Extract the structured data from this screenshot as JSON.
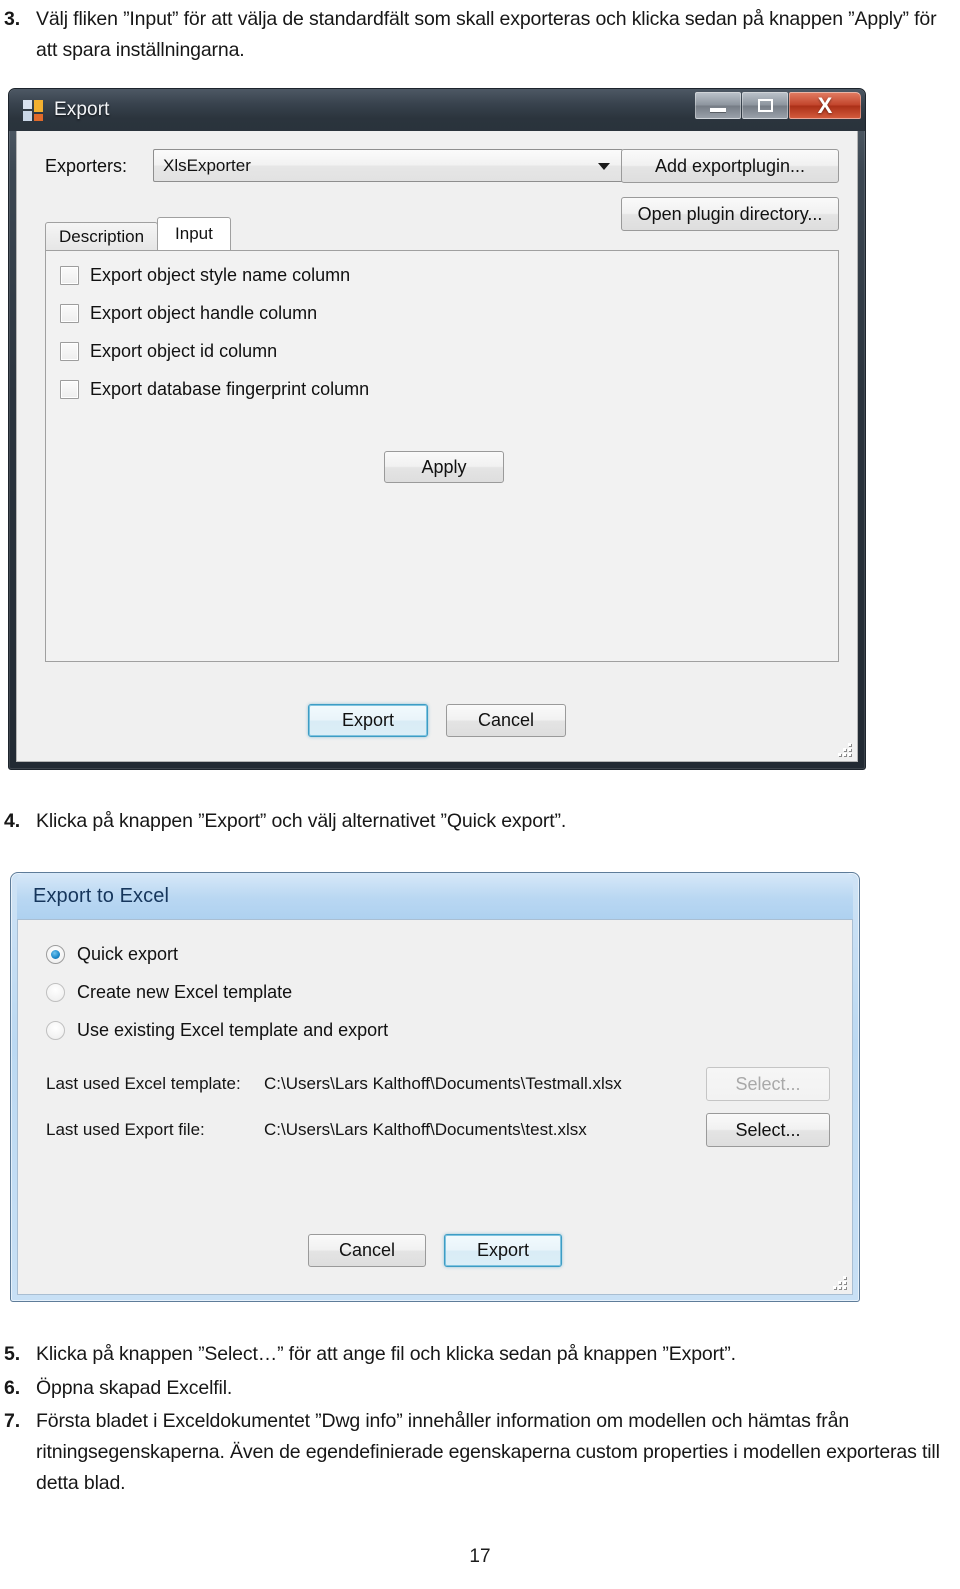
{
  "document": {
    "page_number": "17",
    "steps": [
      {
        "number": "3.",
        "text": "Välj fliken ”Input” för att välja de standardfält som skall exporteras och klicka sedan på knappen ”Apply” för att spara inställningarna."
      },
      {
        "number": "4.",
        "text": "Klicka på knappen ”Export” och välj alternativet ”Quick export”."
      },
      {
        "number": "5.",
        "text": "Klicka på knappen ”Select…” för att ange fil och klicka sedan på knappen ”Export”."
      },
      {
        "number": "6.",
        "text": "Öppna skapad Excelfil."
      },
      {
        "number": "7.",
        "text": "Första bladet i Exceldokumentet ”Dwg info” innehåller information om modellen och hämtas från ritningsegenskaperna. Även de egendefinierade egenskaperna custom properties i modellen exporteras till detta blad."
      }
    ]
  },
  "export_dialog": {
    "title": "Export",
    "caption_buttons": {
      "minimize": "minimize-icon",
      "maximize": "maximize-icon",
      "close": "X"
    },
    "exporters": {
      "label": "Exporters:",
      "selected": "XlsExporter",
      "options": [
        "XlsExporter"
      ]
    },
    "side_buttons": [
      {
        "label": "Add exportplugin..."
      },
      {
        "label": "Open plugin directory..."
      }
    ],
    "tabs": [
      {
        "label": "Description",
        "active": false
      },
      {
        "label": "Input",
        "active": true
      }
    ],
    "checkboxes": [
      {
        "label": "Export object style name column",
        "checked": false
      },
      {
        "label": "Export object handle column",
        "checked": false
      },
      {
        "label": "Export object id column",
        "checked": false
      },
      {
        "label": "Export database fingerprint column",
        "checked": false
      }
    ],
    "apply_button": "Apply",
    "footer_buttons": [
      {
        "label": "Export",
        "default": true
      },
      {
        "label": "Cancel",
        "default": false
      }
    ]
  },
  "excel_dialog": {
    "title": "Export to Excel",
    "radios": [
      {
        "label": "Quick export",
        "checked": true,
        "enabled": true
      },
      {
        "label": "Create new Excel template",
        "checked": false,
        "enabled": false
      },
      {
        "label": "Use existing Excel template and export",
        "checked": false,
        "enabled": false
      }
    ],
    "paths": [
      {
        "caption": "Last used Excel template:",
        "value": "C:\\Users\\Lars Kalthoff\\Documents\\Testmall.xlsx",
        "button": "Select...",
        "button_enabled": false
      },
      {
        "caption": "Last used Export file:",
        "value": "C:\\Users\\Lars Kalthoff\\Documents\\test.xlsx",
        "button": "Select...",
        "button_enabled": true
      }
    ],
    "footer_buttons": [
      {
        "label": "Cancel",
        "default": false
      },
      {
        "label": "Export",
        "default": true
      }
    ]
  },
  "colors": {
    "titlebar_dark": "#2b343e",
    "aero_titlebar": "#b9d7f2",
    "close_red": "#c2452c",
    "focus_blue": "#3d9cc4",
    "radio_blue": "#1b87c9"
  }
}
